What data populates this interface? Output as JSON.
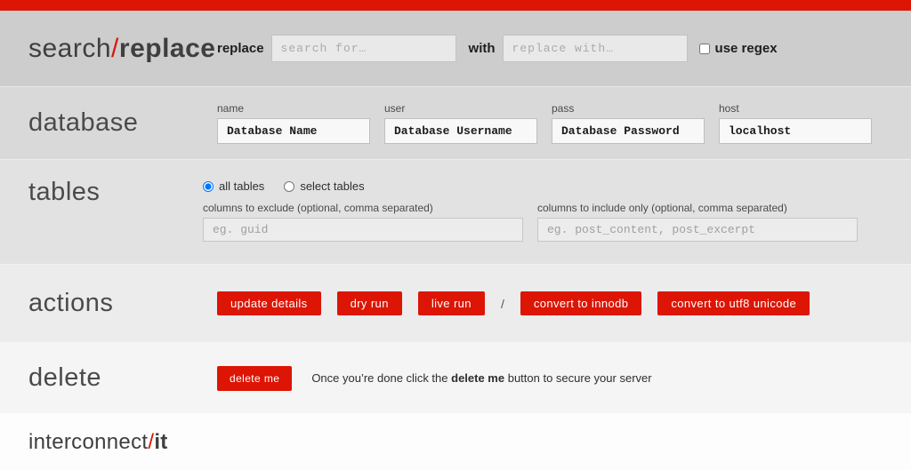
{
  "colors": {
    "accent_red": "#dc1505",
    "band_search": "#cdcdcd",
    "band_database": "#d9d9d9",
    "band_tables": "#e2e2e2",
    "band_actions": "#ececec",
    "band_delete": "#f5f5f5",
    "footer_bg": "#fdfdfd"
  },
  "header": {
    "title_part1": "search",
    "title_slash": "/",
    "title_part2": "replace",
    "replace_label": "replace",
    "search_placeholder": "search for…",
    "with_label": "with",
    "replace_placeholder": "replace with…",
    "use_regex_label": "use regex",
    "use_regex_checked": false
  },
  "database": {
    "heading": "database",
    "fields": [
      {
        "label": "name",
        "value": "Database Name"
      },
      {
        "label": "user",
        "value": "Database Username"
      },
      {
        "label": "pass",
        "value": "Database Password"
      },
      {
        "label": "host",
        "value": "localhost"
      }
    ]
  },
  "tables": {
    "heading": "tables",
    "radio_all_label": "all tables",
    "radio_select_label": "select tables",
    "all_tables_selected": true,
    "select_tables_selected": false,
    "exclude_label": "columns to exclude (optional, comma separated)",
    "exclude_placeholder": "eg. guid",
    "include_label": "columns to include only (optional, comma separated)",
    "include_placeholder": "eg. post_content, post_excerpt"
  },
  "actions": {
    "heading": "actions",
    "buttons": [
      "update details",
      "dry run",
      "live run"
    ],
    "separator": "/",
    "convert_buttons": [
      "convert to innodb",
      "convert to utf8 unicode"
    ]
  },
  "delete": {
    "heading": "delete",
    "button_label": "delete me",
    "note_before": "Once you’re done click the ",
    "note_bold": "delete me",
    "note_after": " button to secure your server"
  },
  "footer": {
    "brand_part1": "interconnect",
    "brand_slash": "/",
    "brand_part2": "it"
  }
}
